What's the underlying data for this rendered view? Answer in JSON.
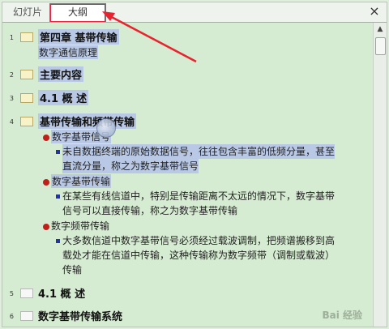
{
  "tabs": [
    {
      "label": "幻灯片",
      "active": false
    },
    {
      "label": "大纲",
      "active": true
    }
  ],
  "close_label": "×",
  "scroll_up_label": "▲",
  "outline": {
    "slide1": {
      "num": "1",
      "title": "第四章      基带传输",
      "subtitle": "数字通信原理"
    },
    "slide2": {
      "num": "2",
      "title": "主要内容"
    },
    "slide3": {
      "num": "3",
      "title": "4.1 概 述"
    },
    "slide4": {
      "num": "4",
      "title": "基带传输和频带传输",
      "item1": "数字基带信号",
      "item1_detail_1": "未自数据终端的原始数据信号，往往包含丰富的低频分量，甚至",
      "item1_detail_2": "直流分量，称之为数字基带信号",
      "item2": "数字基带传输",
      "item2_detail_1": "在某些有线信道中，特别是传输距离不太远的情况下，数字基带",
      "item2_detail_2": "信号可以直接传输，称之为数字基带传输",
      "item3": "数字频带传输",
      "item3_detail_1": "大多数信道中数字基带信号必须经过载波调制，把频谱搬移到高",
      "item3_detail_2": "载处才能在信道中传输，这种传输称为数字频带（调制或载波）",
      "item3_detail_3": "传输"
    },
    "slide5": {
      "num": "5",
      "title": "4.1 概 述"
    },
    "slide6": {
      "num": "6",
      "title": "数字基带传输系统"
    }
  },
  "watermark": "Bai 经验",
  "colors": {
    "annotation_arrow": "#e8222e",
    "selection": "#b9c8e4",
    "bullet": "#c0201a",
    "sub_bullet": "#2533a8"
  }
}
